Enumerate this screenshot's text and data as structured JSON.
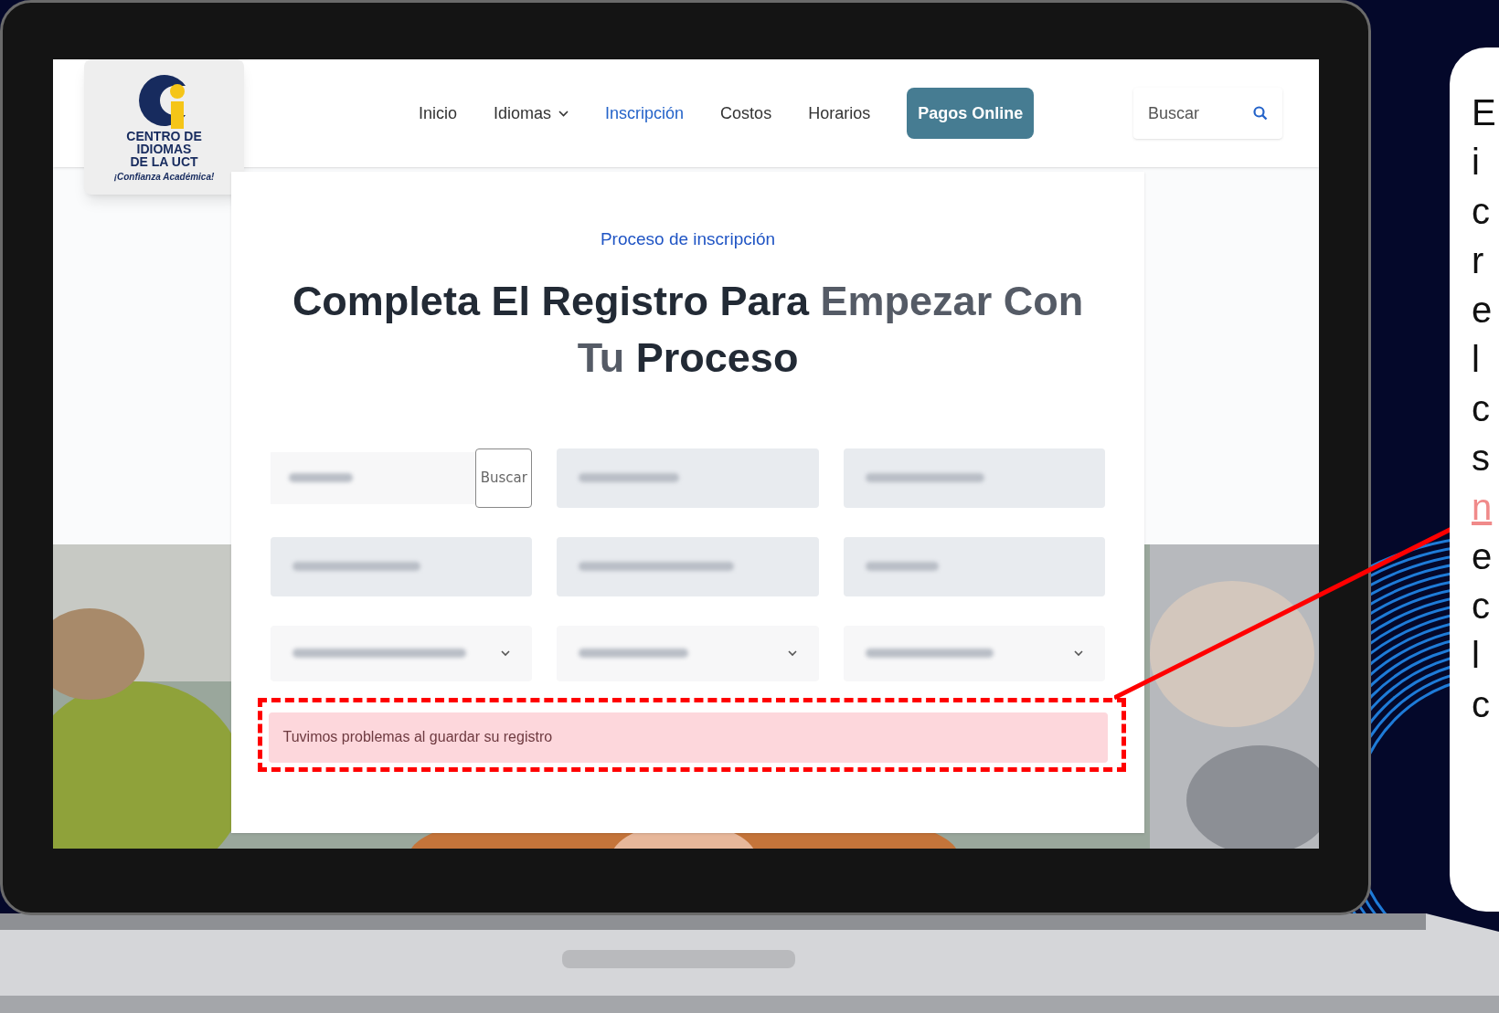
{
  "navbar": {
    "items": [
      {
        "label": "Inicio",
        "selected": false,
        "dropdown": false
      },
      {
        "label": "Idiomas",
        "selected": false,
        "dropdown": true
      },
      {
        "label": "Inscripción",
        "selected": true,
        "dropdown": false
      },
      {
        "label": "Costos",
        "selected": false,
        "dropdown": false
      },
      {
        "label": "Horarios",
        "selected": false,
        "dropdown": false
      }
    ],
    "cta": "Pagos Online",
    "search": {
      "placeholder": "Buscar"
    },
    "logo": {
      "lines": [
        "CENTRO DE",
        "IDIOMAS",
        "DE LA UCT"
      ],
      "tagline": "¡Confianza Académica!"
    }
  },
  "form": {
    "eyebrow": "Proceso de inscripción",
    "heading": [
      {
        "text": "Completa El Registro Para",
        "accent": false
      },
      {
        "text": "Empezar Con Tu",
        "accent": true
      },
      {
        "text": "Proceso",
        "accent": false
      }
    ],
    "fields": [
      {
        "kind": "search",
        "button": "Buscar"
      },
      {
        "kind": "text"
      },
      {
        "kind": "text"
      },
      {
        "kind": "text"
      },
      {
        "kind": "text"
      },
      {
        "kind": "text"
      },
      {
        "kind": "select"
      },
      {
        "kind": "select"
      },
      {
        "kind": "select"
      }
    ],
    "alert": "Tuvimos problemas al guardar su registro"
  },
  "callout": {
    "lines": [
      {
        "text": "E",
        "kind": "text"
      },
      {
        "text": "i",
        "kind": "text"
      },
      {
        "text": "c",
        "kind": "text"
      },
      {
        "text": "r",
        "kind": "text"
      },
      {
        "text": "e",
        "kind": "text"
      },
      {
        "text": "l",
        "kind": "text"
      },
      {
        "text": "c",
        "kind": "text"
      },
      {
        "text": "s",
        "kind": "text"
      },
      {
        "text": "n",
        "kind": "link"
      },
      {
        "text": "e",
        "kind": "text"
      },
      {
        "text": "c",
        "kind": "text"
      },
      {
        "text": "l",
        "kind": "text"
      },
      {
        "text": "c",
        "kind": "text"
      }
    ]
  }
}
